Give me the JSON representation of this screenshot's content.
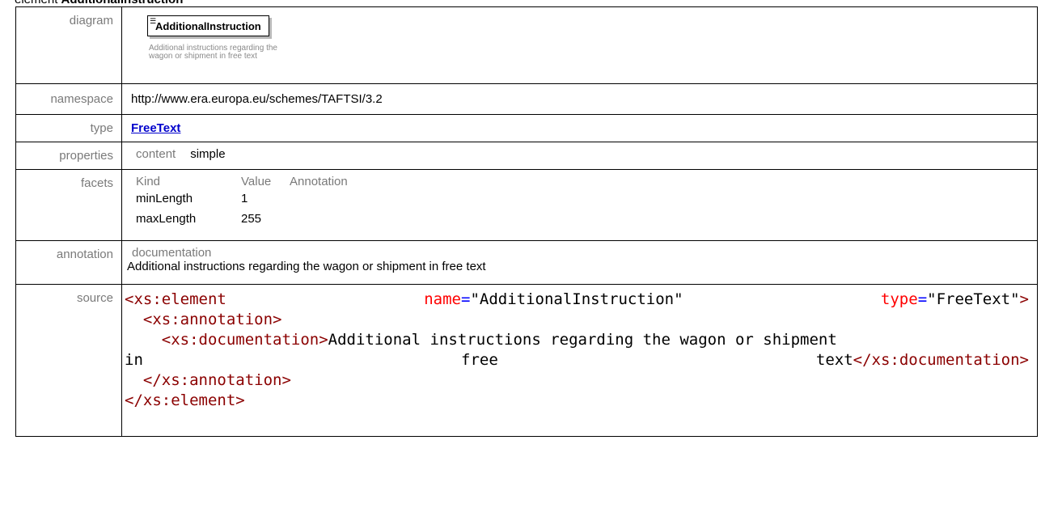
{
  "page_heading": {
    "prefix": "element",
    "name": "AdditionalInstruction"
  },
  "rows": {
    "diagram": {
      "label": "diagram",
      "element_name": "AdditionalInstruction",
      "caption": "Additional instructions regarding the wagon or shipment in free text"
    },
    "namespace": {
      "label": "namespace",
      "value": "http://www.era.europa.eu/schemes/TAFTSI/3.2"
    },
    "type": {
      "label": "type",
      "value": "FreeText"
    },
    "properties": {
      "label": "properties",
      "key": "content",
      "value": "simple"
    },
    "facets": {
      "label": "facets",
      "headers": [
        "Kind",
        "Value",
        "Annotation"
      ],
      "items": [
        {
          "kind": "minLength",
          "value": "1"
        },
        {
          "kind": "maxLength",
          "value": "255"
        }
      ]
    },
    "annotation": {
      "label": "annotation",
      "key": "documentation",
      "text": "Additional instructions regarding the wagon or shipment in free text"
    },
    "source": {
      "label": "source",
      "l1_tag": "<xs:element",
      "l1_attr1": "name",
      "l1_val1": "\"AdditionalInstruction\"",
      "l1_attr2": "type",
      "l1_val2": "\"FreeText\"",
      "l1_end": ">",
      "l2": "<xs:annotation>",
      "l3_tag": "<xs:documentation>",
      "l3_text": "Additional instructions regarding the wagon or shipment",
      "l4_w1": "in",
      "l4_w2": "free",
      "l4_w3": "text",
      "l4_end": "</xs:documentation>",
      "l5": "</xs:annotation>",
      "l6": "</xs:element>"
    }
  }
}
